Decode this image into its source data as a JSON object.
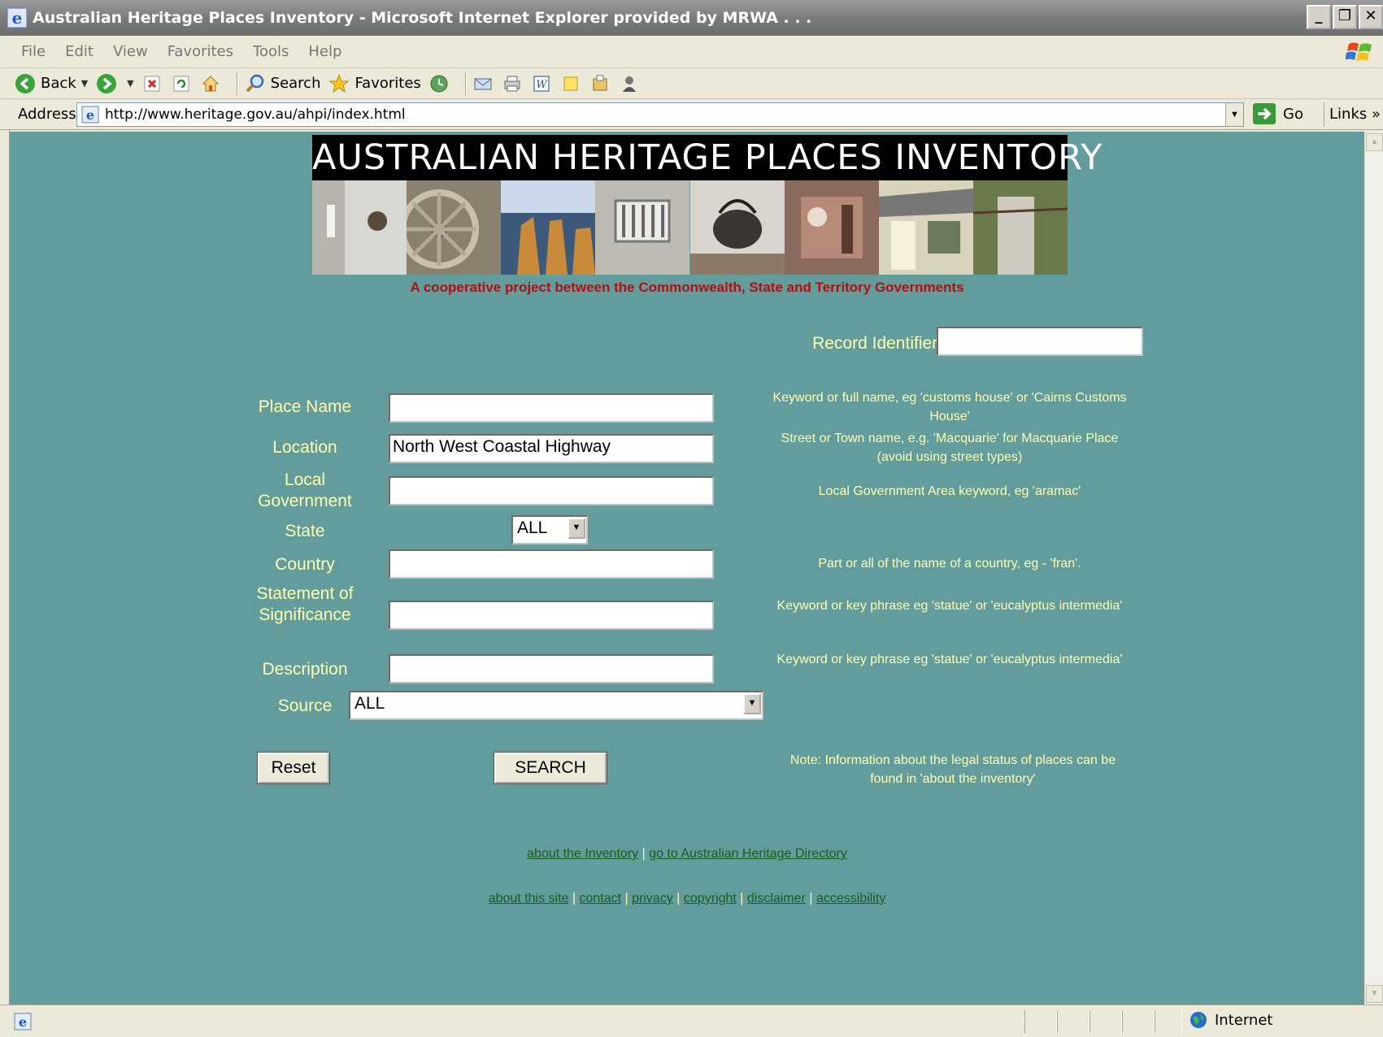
{
  "window": {
    "title": "Australian Heritage Places Inventory - Microsoft Internet Explorer provided by MRWA . . ."
  },
  "menubar": [
    "File",
    "Edit",
    "View",
    "Favorites",
    "Tools",
    "Help"
  ],
  "toolbar": {
    "back": "Back",
    "search": "Search",
    "favorites": "Favorites"
  },
  "address": {
    "label": "Address",
    "url": "http://www.heritage.gov.au/ahpi/index.html",
    "go": "Go",
    "links": "Links"
  },
  "banner": {
    "title": "AUSTRALIAN HERITAGE PLACES INVENTORY",
    "tagline": "A cooperative project between the Commonwealth, State and Territory Governments"
  },
  "form": {
    "record_identifier_label": "Record Identifier:",
    "record_identifier_value": "",
    "place_name_label": "Place Name",
    "place_name_value": "",
    "place_name_hint": "Keyword or full name, eg 'customs house' or 'Cairns Customs House'",
    "location_label": "Location",
    "location_value": "North West Coastal Highway",
    "location_hint": "Street or Town name, e.g. 'Macquarie' for Macquarie Place (avoid using street types)",
    "local_gov_label": "Local Government",
    "local_gov_value": "",
    "local_gov_hint": "Local Government Area keyword, eg 'aramac'",
    "state_label": "State",
    "state_value": "ALL",
    "country_label": "Country",
    "country_value": "",
    "country_hint": "Part or all of the name of a country, eg - 'fran'.",
    "significance_label": "Statement of Significance",
    "significance_value": "",
    "significance_hint": "Keyword or key phrase eg 'statue' or 'eucalyptus intermedia'",
    "description_label": "Description",
    "description_value": "",
    "description_hint": "Keyword or key phrase eg 'statue' or 'eucalyptus intermedia'",
    "source_label": "Source",
    "source_value": "ALL",
    "reset_label": "Reset",
    "search_label": "SEARCH",
    "note": "Note: Information about the legal status of places can be found in 'about the inventory'"
  },
  "links_row1": {
    "about_inventory": "about the Inventory",
    "sep": "|",
    "directory": "go to Australian Heritage Directory"
  },
  "links_row2": {
    "about_site": "about this site",
    "contact": "contact",
    "privacy": "privacy",
    "copyright": "copyright",
    "disclaimer": "disclaimer",
    "accessibility": "accessibility",
    "sep": "|"
  },
  "statusbar": {
    "zone": "Internet"
  },
  "colors": {
    "page_background": "#639c9c",
    "label_text": "#ffffb0",
    "tagline": "#b01010",
    "link": "#1e5a1e"
  }
}
